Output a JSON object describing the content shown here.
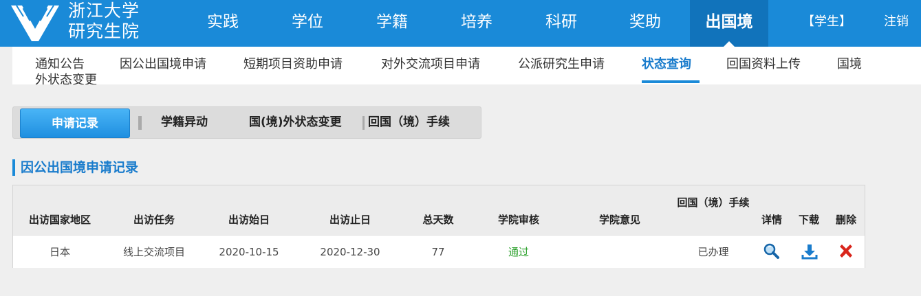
{
  "header": {
    "logo_line1": "浙江大学",
    "logo_line2": "研究生院",
    "nav": [
      "实践",
      "学位",
      "学籍",
      "培养",
      "科研",
      "奖助",
      "出国境"
    ],
    "active_nav": "出国境",
    "user": "【学生】",
    "logout": "注销"
  },
  "subnav": {
    "items": [
      "通知公告",
      "因公出国境申请",
      "短期项目资助申请",
      "对外交流项目申请",
      "公派研究生申请",
      "状态查询",
      "回国资料上传",
      "国境"
    ],
    "wrap_text": "外状态变更",
    "active": "状态查询"
  },
  "tabs": {
    "items": [
      "申请记录",
      "学籍异动",
      "国(境)外状态变更",
      "回国（境）手续"
    ],
    "active": "申请记录"
  },
  "section": {
    "title": "因公出国境申请记录"
  },
  "table": {
    "headers": [
      "出访国家地区",
      "出访任务",
      "出访始日",
      "出访止日",
      "总天数",
      "学院审核",
      "学院意见",
      "回国（境）手续",
      "详情",
      "下载",
      "删除"
    ],
    "rows": [
      {
        "country": "日本",
        "task": "线上交流项目",
        "start": "2020-10-15",
        "end": "2020-12-30",
        "days": "77",
        "review": "通过",
        "opinion": "",
        "return_status": "已办理"
      }
    ]
  },
  "colors": {
    "brand_blue": "#1a8ad8",
    "nav_active": "#1173bb",
    "pass_green": "#2aa02a",
    "delete_red": "#d9261c"
  },
  "icons": {
    "details": "search-icon",
    "download": "download-icon",
    "delete": "close-icon"
  }
}
